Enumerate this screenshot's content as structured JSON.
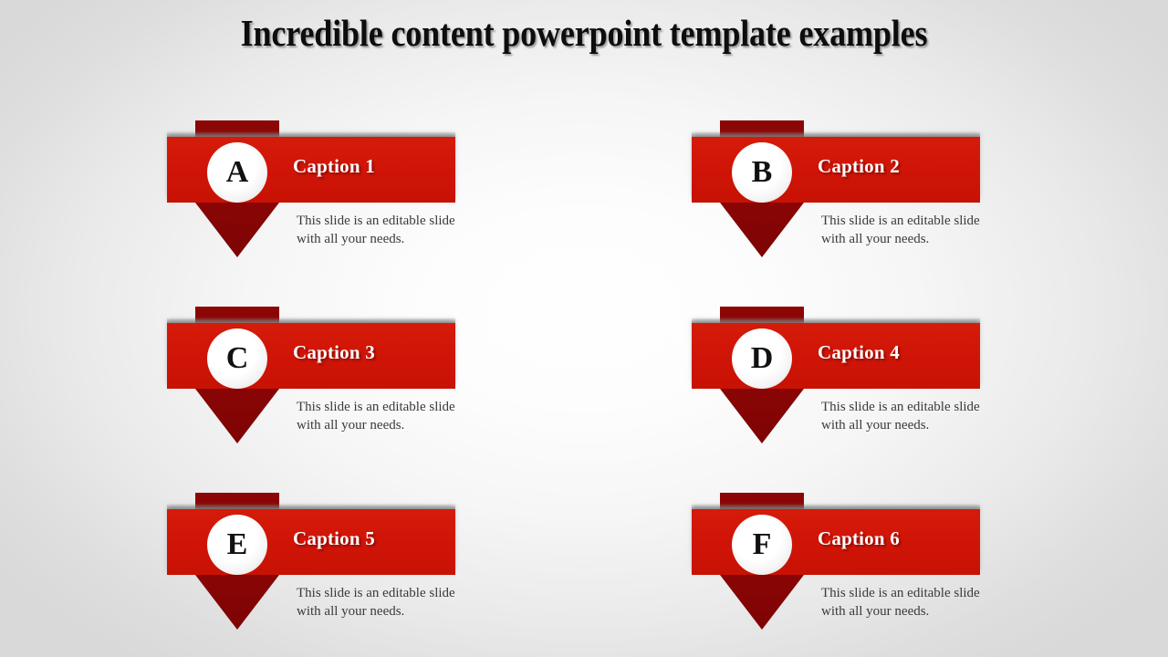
{
  "slide": {
    "title": "Incredible content powerpoint template examples",
    "background": {
      "center_color": "#fdfdfd",
      "edge_color": "#dcdcdc"
    },
    "theme": {
      "banner_color": "#cf1407",
      "ribbon_color": "#8a0505",
      "badge_color": "#ffffff",
      "caption_color": "#ffffff",
      "body_text_color": "#3a3a3a",
      "title_color": "#0d0d0d"
    }
  },
  "cards": [
    {
      "letter": "A",
      "caption": "Caption 1",
      "body": "This slide is an editable slide with all your needs."
    },
    {
      "letter": "B",
      "caption": "Caption 2",
      "body": "This slide is an editable slide with all your needs."
    },
    {
      "letter": "C",
      "caption": "Caption 3",
      "body": "This slide is an editable slide with all your needs."
    },
    {
      "letter": "D",
      "caption": "Caption 4",
      "body": "This slide is an editable slide with all your needs."
    },
    {
      "letter": "E",
      "caption": "Caption 5",
      "body": "This slide is an editable slide with all your needs."
    },
    {
      "letter": "F",
      "caption": "Caption 6",
      "body": "This slide is an editable slide with all your needs."
    }
  ]
}
